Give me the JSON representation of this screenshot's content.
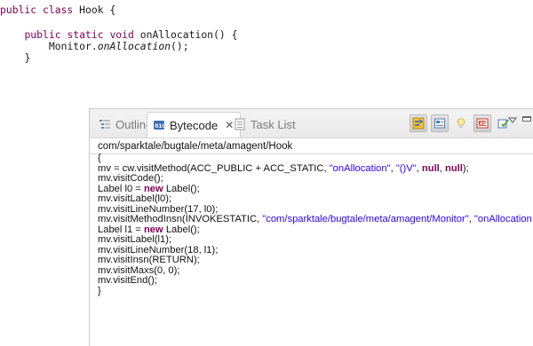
{
  "editor": {
    "lines": [
      {
        "indent": "",
        "kw": "public class ",
        "rest": "Hook {"
      },
      {
        "indent": "    ",
        "kw": "public static void ",
        "rest": "onAllocation() {"
      },
      {
        "indent": "        ",
        "pre": "Monitor.",
        "italic": "onAllocation",
        "post": "();"
      },
      {
        "indent": "    ",
        "rest": "}"
      }
    ]
  },
  "view": {
    "tabs": {
      "outline": {
        "label": "Outline",
        "icon": "outline-icon"
      },
      "bytecode": {
        "label": "Bytecode",
        "icon": "bytecode-icon",
        "close": "✕"
      },
      "tasklist": {
        "label": "Task List",
        "icon": "tasklist-icon"
      }
    },
    "toolbar_icons": [
      "link-with-editor-icon",
      "show-raw-bytecode-icon",
      "hint-icon",
      "asmifier-icon",
      "sync-icon"
    ],
    "class_name": "com/sparktale/bugtale/meta/amagent/Hook",
    "bytecode_lines": [
      [
        {
          "t": "{"
        }
      ],
      [
        {
          "t": "mv = cw.visitMethod(ACC_PUBLIC + ACC_STATIC, "
        },
        {
          "t": "\"onAllocation\"",
          "c": "str"
        },
        {
          "t": ", "
        },
        {
          "t": "\"()V\"",
          "c": "str"
        },
        {
          "t": ", "
        },
        {
          "t": "null",
          "c": "kw"
        },
        {
          "t": ", "
        },
        {
          "t": "null",
          "c": "kw"
        },
        {
          "t": ");"
        }
      ],
      [
        {
          "t": "mv.visitCode();"
        }
      ],
      [
        {
          "t": "Label l0 = "
        },
        {
          "t": "new",
          "c": "kw"
        },
        {
          "t": " Label();"
        }
      ],
      [
        {
          "t": "mv.visitLabel(l0);"
        }
      ],
      [
        {
          "t": "mv.visitLineNumber(17, l0);"
        }
      ],
      [
        {
          "t": "mv.visitMethodInsn(INVOKESTATIC, "
        },
        {
          "t": "\"com/sparktale/bugtale/meta/amagent/Monitor\"",
          "c": "str"
        },
        {
          "t": ", "
        },
        {
          "t": "\"onAllocation\"",
          "c": "str"
        },
        {
          "t": ", "
        },
        {
          "t": "\"(",
          "c": "str"
        }
      ],
      [
        {
          "t": "Label l1 = "
        },
        {
          "t": "new",
          "c": "kw"
        },
        {
          "t": " Label();"
        }
      ],
      [
        {
          "t": "mv.visitLabel(l1);"
        }
      ],
      [
        {
          "t": "mv.visitLineNumber(18, l1);"
        }
      ],
      [
        {
          "t": "mv.visitInsn(RETURN);"
        }
      ],
      [
        {
          "t": "mv.visitMaxs(0, 0);"
        }
      ],
      [
        {
          "t": "mv.visitEnd();"
        }
      ],
      [
        {
          "t": "}"
        }
      ]
    ]
  },
  "colors": {
    "java_keyword": "#7f0055",
    "string_literal": "#2a00ff"
  }
}
